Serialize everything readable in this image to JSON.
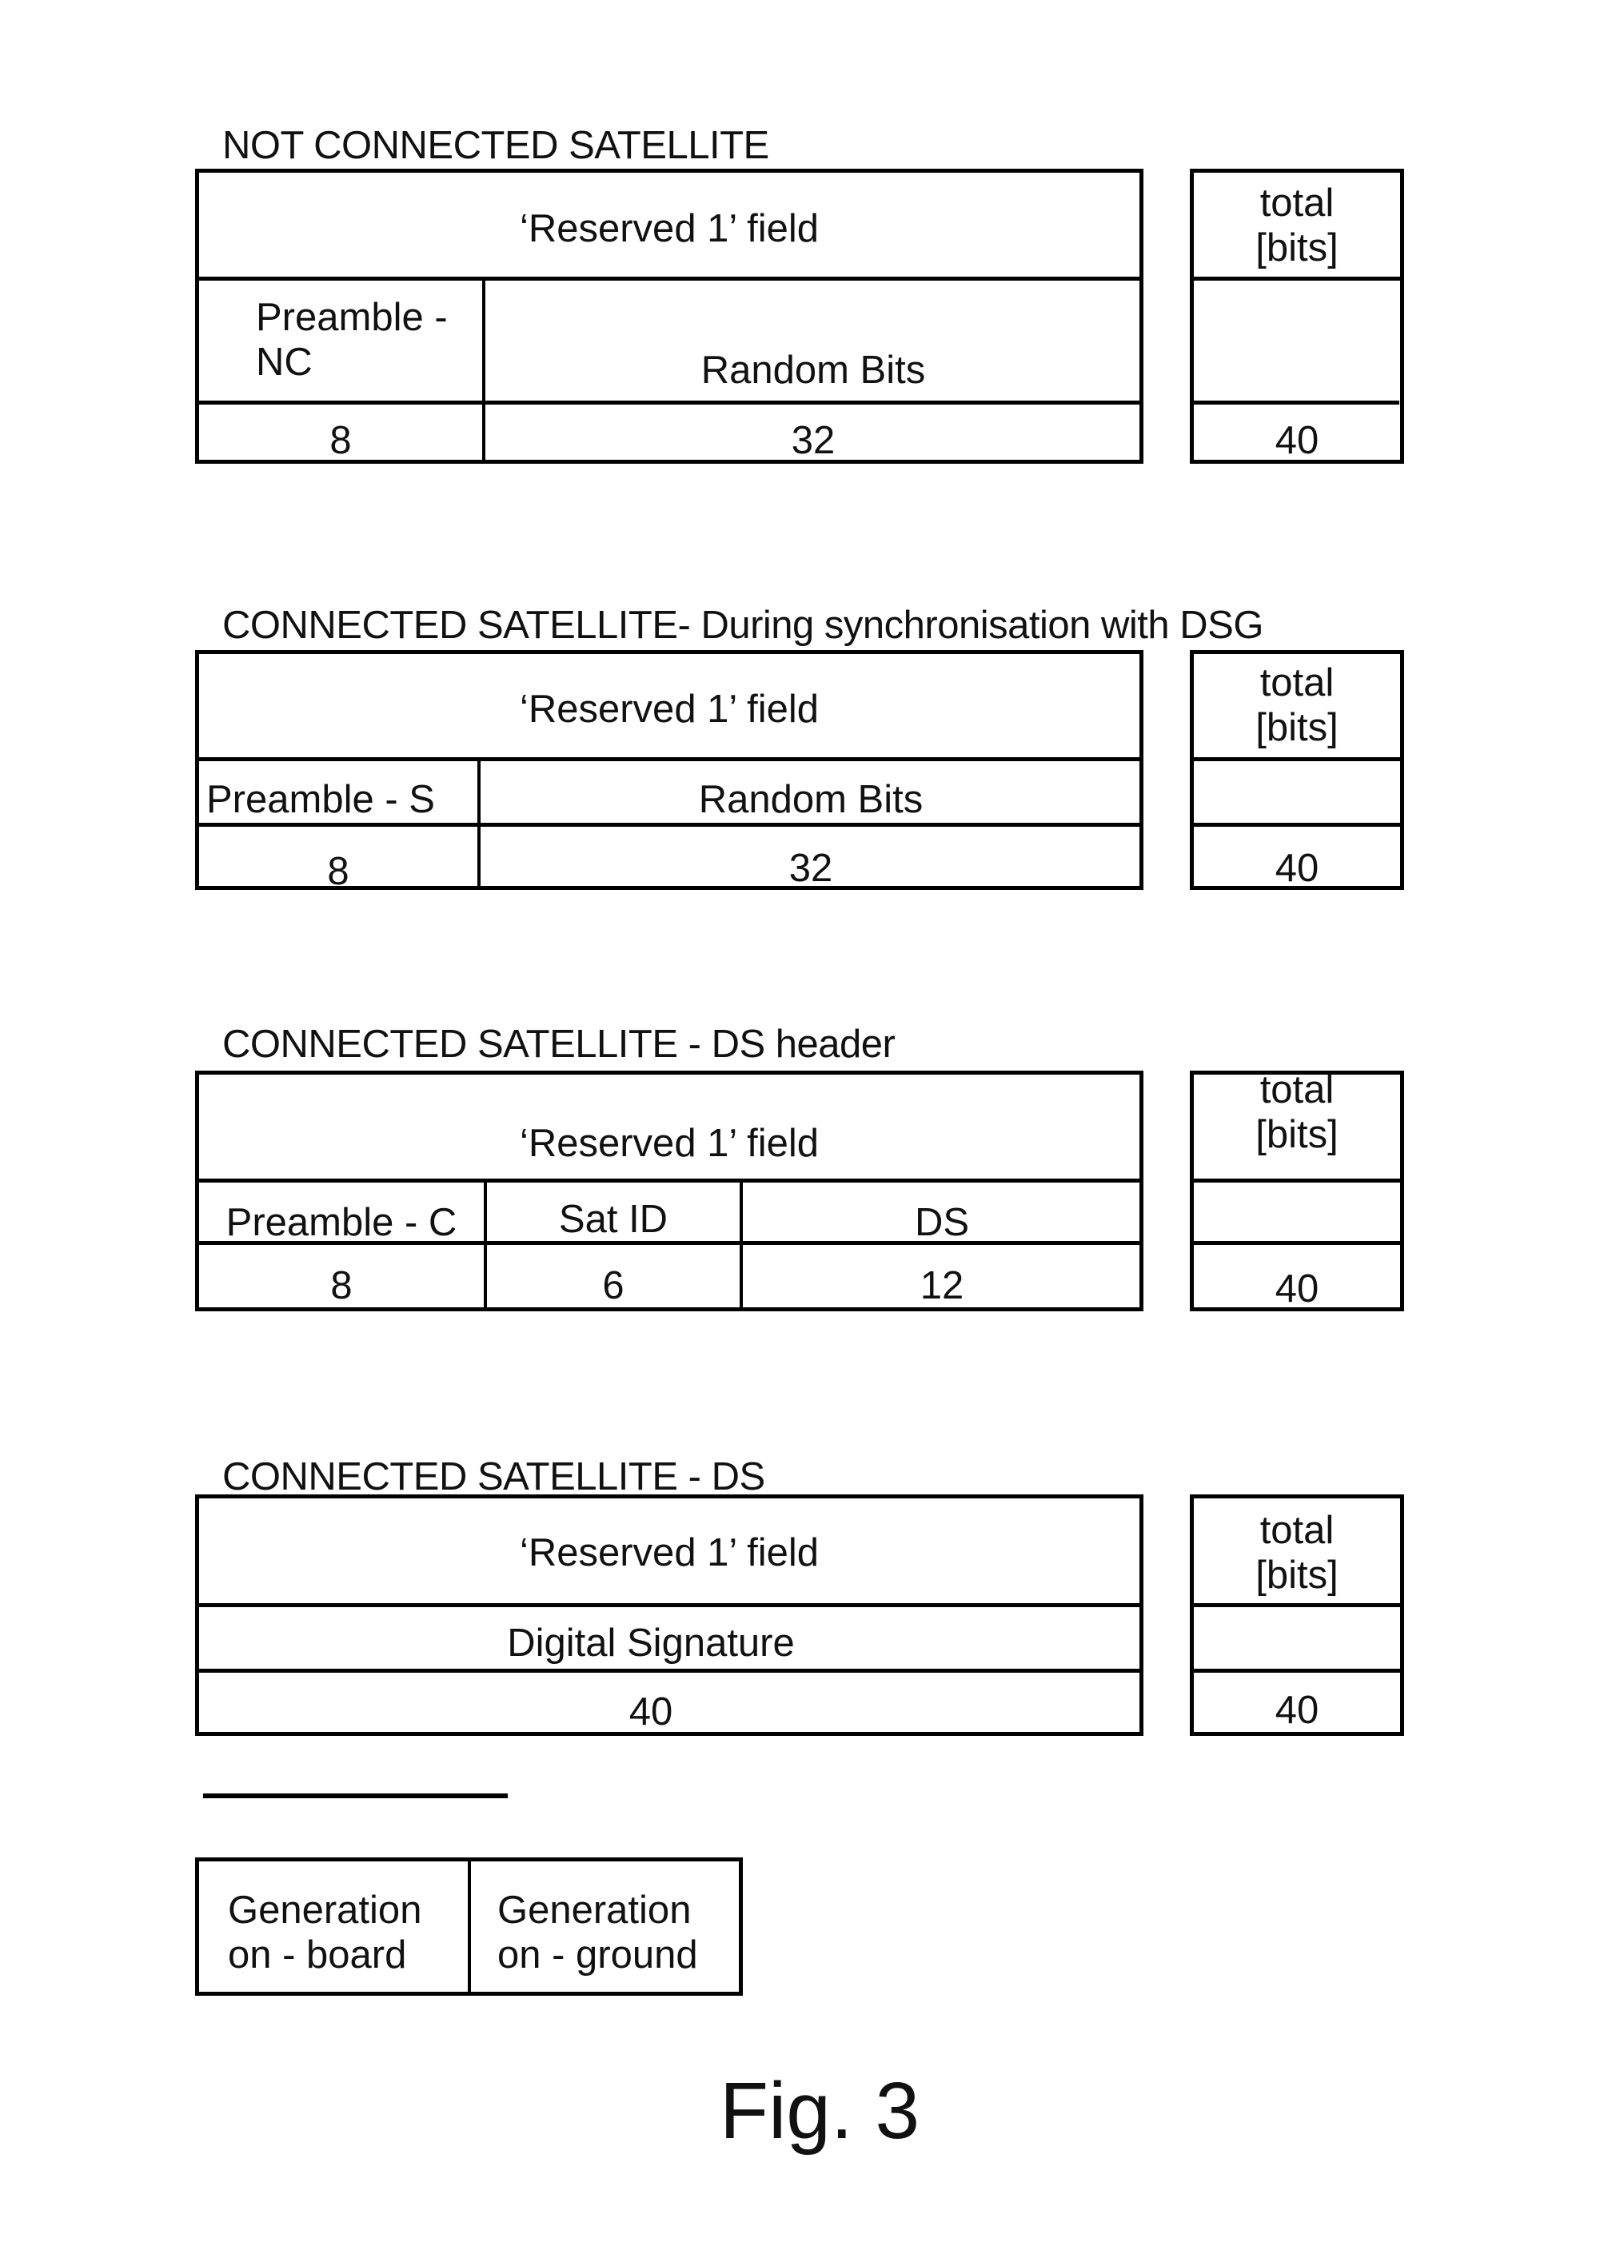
{
  "figure_label": "Fig. 3",
  "sections": [
    {
      "title": "NOT CONNECTED SATELLITE",
      "header": "‘Reserved 1’ field",
      "fields": [
        {
          "name": "Preamble -\nNC",
          "bits": "8"
        },
        {
          "name": "Random Bits",
          "bits": "32"
        }
      ],
      "total_header": "total\n[bits]",
      "total_bits": "40"
    },
    {
      "title": "CONNECTED SATELLITE- During synchronisation with DSG",
      "header": "‘Reserved 1’ field",
      "fields": [
        {
          "name": "Preamble - S",
          "bits": "8"
        },
        {
          "name": "Random Bits",
          "bits": "32"
        }
      ],
      "total_header": "total\n[bits]",
      "total_bits": "40"
    },
    {
      "title": "CONNECTED SATELLITE - DS header",
      "header": "‘Reserved 1’ field",
      "fields": [
        {
          "name": "Preamble - C",
          "bits": "8"
        },
        {
          "name": "Sat ID",
          "bits": "6"
        },
        {
          "name": "DS",
          "bits": "12"
        }
      ],
      "total_header": "total\n[bits]",
      "total_bits": "40"
    },
    {
      "title": "CONNECTED SATELLITE - DS",
      "header": "‘Reserved 1’ field",
      "fields": [
        {
          "name": "Digital Signature",
          "bits": "40"
        }
      ],
      "total_header": "total\n[bits]",
      "total_bits": "40"
    }
  ],
  "legend": [
    {
      "label": "Generation\non - board"
    },
    {
      "label": "Generation\non - ground"
    }
  ]
}
